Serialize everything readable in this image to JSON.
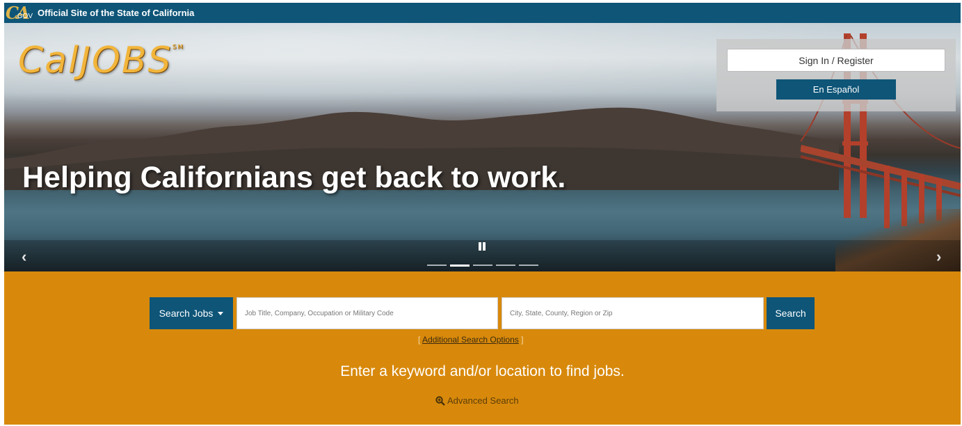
{
  "header": {
    "ca_logo_text": "CA",
    "ca_logo_suffix": ".GOV",
    "official_text": "Official Site of the State of California"
  },
  "hero": {
    "logo_text": "CalJOBS",
    "logo_mark": "SM",
    "headline": "Helping Californians get back to work.",
    "carousel": {
      "slide_count": 5,
      "active_index": 1
    }
  },
  "login": {
    "signin_label": "Sign In / Register",
    "espanol_label": "En Español"
  },
  "search": {
    "type_label": "Search Jobs",
    "keyword_placeholder": "Job Title, Company, Occupation or Military Code",
    "location_placeholder": "City, State, County, Region or Zip",
    "submit_label": "Search",
    "additional_options": "Additional Search Options",
    "tagline": "Enter a keyword and/or location to find jobs.",
    "advanced_label": "Advanced Search"
  },
  "icons": {
    "pause": "pause-icon",
    "prev": "chevron-left-icon",
    "next": "chevron-right-icon",
    "advanced": "magnify-plus-icon"
  },
  "colors": {
    "brand_blue": "#0e5578",
    "search_orange": "#d8890b",
    "logo_gold": "#f2b53a"
  }
}
